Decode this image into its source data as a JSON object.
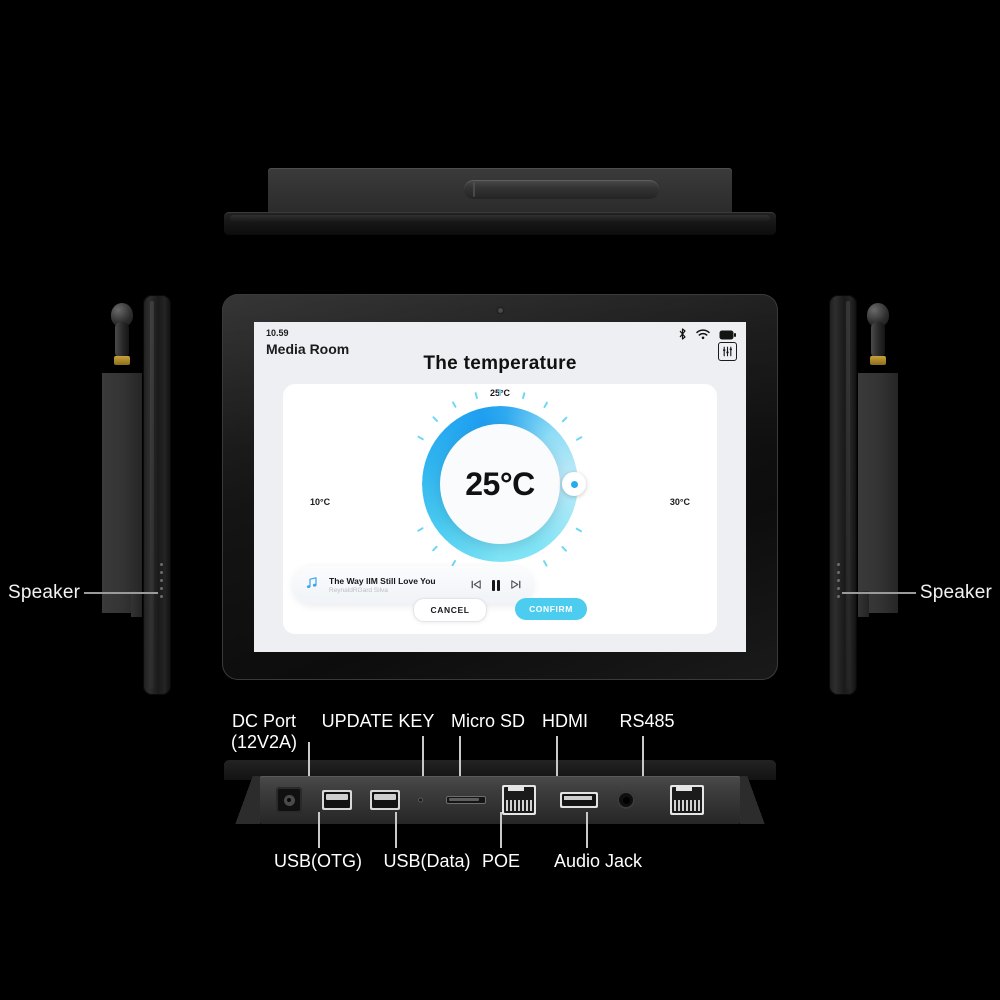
{
  "product": {
    "views": {
      "top": "top-view",
      "left_side": "left-side-view",
      "right_side": "right-side-view",
      "front": "front-view",
      "bottom_io": "bottom-io-view"
    }
  },
  "speaker_labels": {
    "left": "Speaker",
    "right": "Speaker"
  },
  "screen": {
    "status": {
      "clock": "10.59",
      "room": "Media Room",
      "icons": [
        "bluetooth-icon",
        "wifi-icon",
        "battery-icon"
      ],
      "equalizer_icon": "equalizer-icon"
    },
    "title": "The  temperature",
    "dial": {
      "value": "25°C",
      "label_top": "25°C",
      "label_min": "10°C",
      "label_max": "30°C",
      "min": 10,
      "max": 30,
      "current": 25,
      "gradient_start": "#7fe4f5",
      "gradient_end": "#1f9ff0",
      "tick_color": "#6fd8f2"
    },
    "player": {
      "note_icon": "music-note-icon",
      "track_title": "The Way IIM Still Love You",
      "artist": "ReynaldRGard Silva",
      "prev_icon": "previous-track-icon",
      "pause_icon": "pause-icon",
      "next_icon": "next-track-icon"
    },
    "buttons": {
      "cancel": "CANCEL",
      "confirm": "CONFIRM",
      "confirm_color": "#4ccdf0"
    }
  },
  "io_ports": {
    "top_labels": [
      {
        "name": "dc-port",
        "line1": "DC Port",
        "line2": "(12V2A)"
      },
      {
        "name": "update-key",
        "line1": "UPDATE KEY",
        "line2": ""
      },
      {
        "name": "micro-sd",
        "line1": "Micro SD",
        "line2": ""
      },
      {
        "name": "hdmi",
        "line1": "HDMI",
        "line2": ""
      },
      {
        "name": "rs485",
        "line1": "RS485",
        "line2": ""
      }
    ],
    "bottom_labels": [
      {
        "name": "usb-otg",
        "text": "USB(OTG)"
      },
      {
        "name": "usb-data",
        "text": "USB(Data)"
      },
      {
        "name": "poe",
        "text": "POE"
      },
      {
        "name": "audio-jack",
        "text": "Audio Jack"
      }
    ]
  }
}
